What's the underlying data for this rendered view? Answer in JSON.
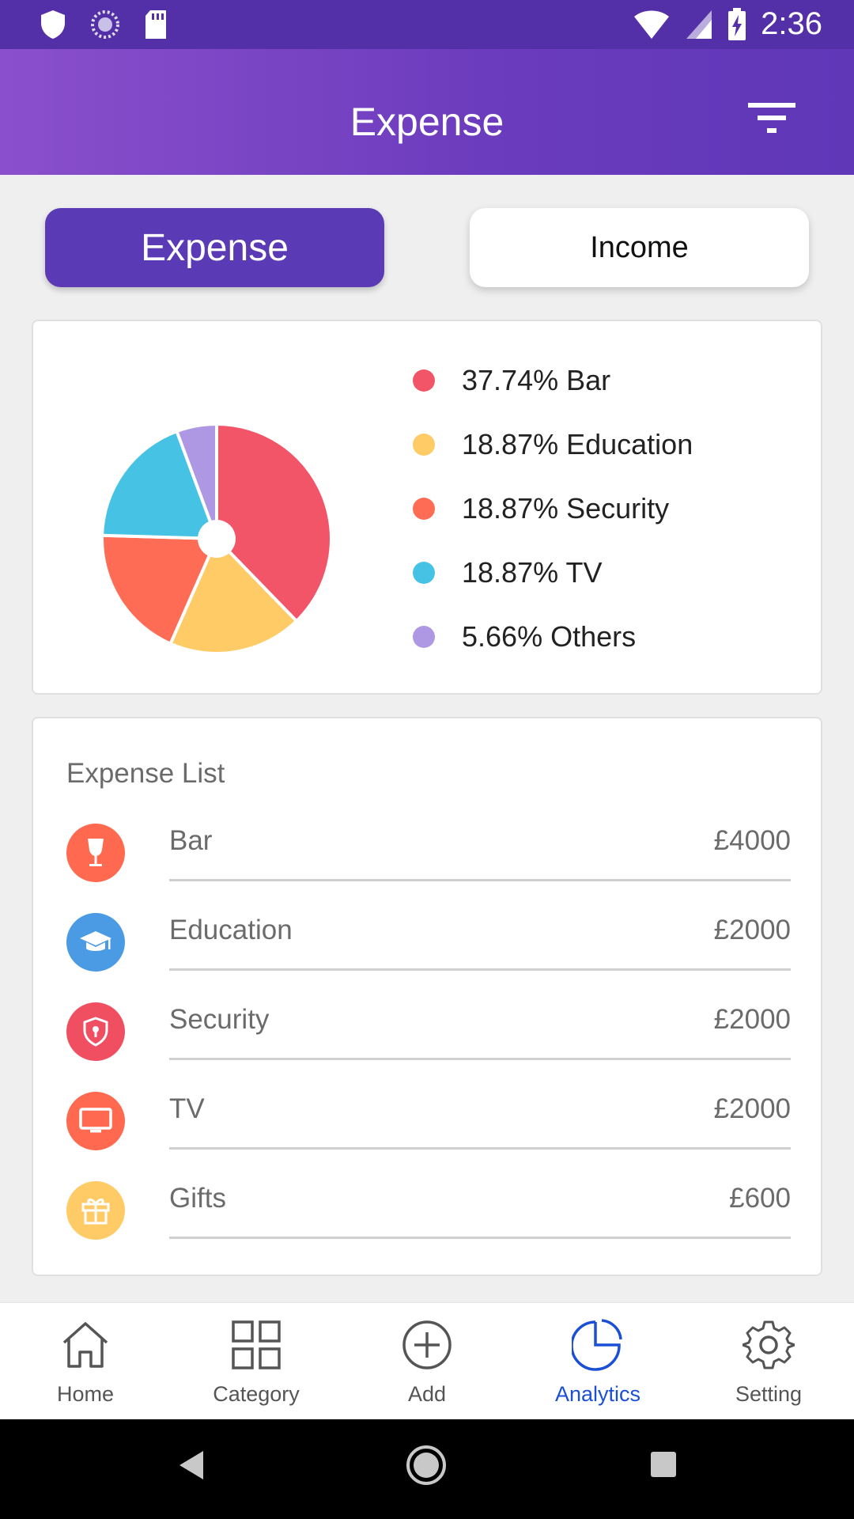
{
  "status_bar": {
    "time": "2:36"
  },
  "app_bar": {
    "title": "Expense",
    "filter_icon": "filter-icon"
  },
  "segment": {
    "expense_label": "Expense",
    "income_label": "Income",
    "selected": "Expense"
  },
  "chart_data": {
    "type": "pie",
    "title": "",
    "slices": [
      {
        "label": "Bar",
        "percent": 37.74,
        "legend": "37.74% Bar",
        "color": "#f25468"
      },
      {
        "label": "Education",
        "percent": 18.87,
        "legend": "18.87% Education",
        "color": "#fecb67"
      },
      {
        "label": "Security",
        "percent": 18.87,
        "legend": "18.87% Security",
        "color": "#ff6c55"
      },
      {
        "label": "TV",
        "percent": 18.87,
        "legend": "18.87% TV",
        "color": "#46c3e4"
      },
      {
        "label": "Others",
        "percent": 5.66,
        "legend": "5.66% Others",
        "color": "#ae98e4"
      }
    ],
    "legend_placement": "right"
  },
  "expense_list": {
    "title": "Expense List",
    "items": [
      {
        "name": "Bar",
        "amount": "£4000",
        "icon": "wine-glass-icon",
        "color": "#ff6950"
      },
      {
        "name": "Education",
        "amount": "£2000",
        "icon": "graduation-cap-icon",
        "color": "#4b9be4"
      },
      {
        "name": "Security",
        "amount": "£2000",
        "icon": "shield-icon",
        "color": "#f04f62"
      },
      {
        "name": "TV",
        "amount": "£2000",
        "icon": "tv-icon",
        "color": "#ff6950"
      },
      {
        "name": "Gifts",
        "amount": "£600",
        "icon": "gift-icon",
        "color": "#fecb67"
      }
    ]
  },
  "bottom_nav": {
    "items": [
      {
        "label": "Home",
        "icon": "home-icon"
      },
      {
        "label": "Category",
        "icon": "grid-icon"
      },
      {
        "label": "Add",
        "icon": "plus-circle-icon"
      },
      {
        "label": "Analytics",
        "icon": "pie-chart-icon",
        "active": true
      },
      {
        "label": "Setting",
        "icon": "gear-icon"
      }
    ]
  },
  "colors": {
    "primary": "#5b3ab5",
    "active_nav": "#1a4fd6"
  }
}
